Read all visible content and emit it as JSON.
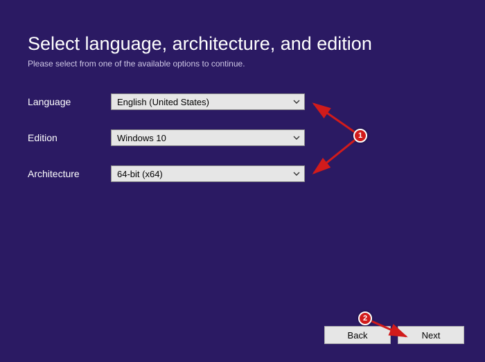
{
  "header": {
    "title": "Select language, architecture, and edition",
    "subtitle": "Please select from one of the available options to continue."
  },
  "form": {
    "language": {
      "label": "Language",
      "value": "English (United States)"
    },
    "edition": {
      "label": "Edition",
      "value": "Windows 10"
    },
    "architecture": {
      "label": "Architecture",
      "value": "64-bit (x64)"
    }
  },
  "footer": {
    "back": "Back",
    "next": "Next"
  },
  "annotations": {
    "badge1": "1",
    "badge2": "2"
  },
  "colors": {
    "background": "#2b1a63",
    "control_bg": "#e6e6e6",
    "annotation": "#d11b1b"
  }
}
